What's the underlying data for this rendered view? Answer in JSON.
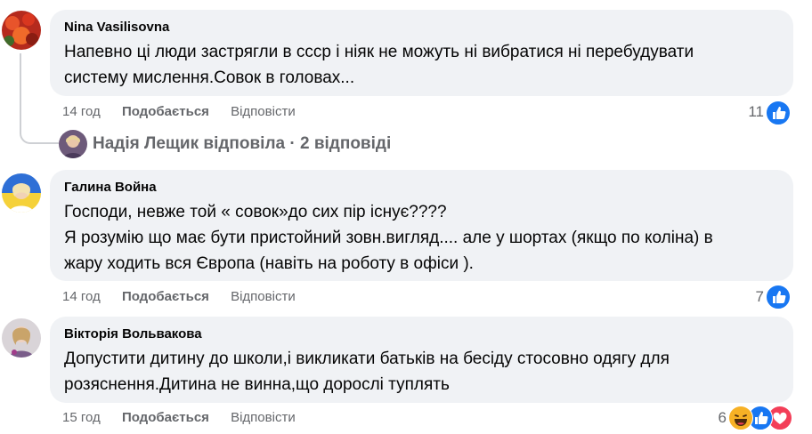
{
  "comments": [
    {
      "author": "Nina Vasilisovna",
      "lines": [
        "Напевно ці люди застрягли в ссср і ніяк не можуть ні вибратися ні перебудувати",
        "систему мислення.Совок в головах..."
      ],
      "time": "14 год",
      "like_label": "Подобається",
      "reply_label": "Відповісти",
      "reaction_count": "11",
      "reactions": [
        "like-icon"
      ]
    },
    {
      "author": "Галина Война",
      "lines": [
        "Господи, невже той « совок»до сих пір існує????",
        "Я розумію що має бути пристойний зовн.вигляд.... але у шортах (якщо по коліна) в",
        "жару ходить вся Європа (навіть на роботу в офіси )."
      ],
      "time": "14 год",
      "like_label": "Подобається",
      "reply_label": "Відповісти",
      "reaction_count": "7",
      "reactions": [
        "like-icon"
      ]
    },
    {
      "author": "Вікторія Вольвакова",
      "lines": [
        "Допустити дитину до школи,і викликати батьків на бесіду стосовно одягу для",
        "розяснення.Дитина не винна,що дорослі туплять"
      ],
      "time": "15 год",
      "like_label": "Подобається",
      "reply_label": "Відповісти",
      "reaction_count": "6",
      "reactions": [
        "haha-icon",
        "like-icon",
        "love-icon"
      ]
    }
  ],
  "reply_summary": "Надія Лещик відповіла · 2 відповіді",
  "colors": {
    "like": "#1877f2",
    "love": "#f33e58",
    "haha": "#f7b125",
    "bubble": "#f0f2f5",
    "meta": "#65676b"
  }
}
